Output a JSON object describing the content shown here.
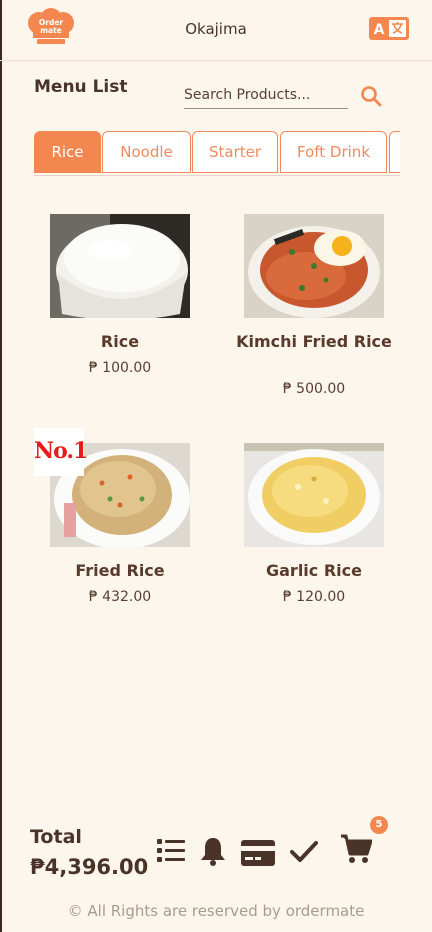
{
  "header": {
    "logo_text": [
      "Order",
      "mate"
    ],
    "restaurant_name": "Okajima"
  },
  "menu": {
    "title": "Menu List",
    "search_placeholder": "Search Products..."
  },
  "tabs": [
    {
      "label": "Rice",
      "active": true
    },
    {
      "label": "Noodle",
      "active": false
    },
    {
      "label": "Starter",
      "active": false
    },
    {
      "label": "Foft Drink",
      "active": false
    }
  ],
  "products": [
    {
      "name": "Rice",
      "price": "₱ 100.00",
      "image": "white-rice-bowl"
    },
    {
      "name": "Kimchi Fried Rice",
      "price": "₱ 500.00",
      "image": "kimchi-fried-rice-with-egg"
    },
    {
      "name": "Fried Rice",
      "price": "₱ 432.00",
      "image": "fried-rice-plate",
      "badge": "No.1"
    },
    {
      "name": "Garlic Rice",
      "price": "₱ 120.00",
      "image": "garlic-rice-plate"
    }
  ],
  "footer": {
    "total_label": "Total",
    "total_amount": "₱4,396.00",
    "cart_count": "5",
    "icons": [
      "list-icon",
      "bell-icon",
      "credit-card-icon",
      "check-icon",
      "cart-icon"
    ],
    "copyright": "© All Rights are reserved by ordermate"
  },
  "colors": {
    "accent": "#f4874f",
    "background": "#fdf6ec",
    "text": "#5a4033"
  }
}
